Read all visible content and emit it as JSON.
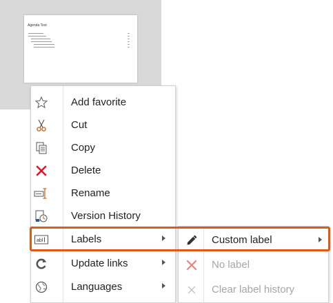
{
  "thumbnail": {
    "title": "Agenda Test"
  },
  "menu": {
    "items": [
      {
        "label": "Add favorite",
        "icon": "star-outline-icon"
      },
      {
        "label": "Cut",
        "icon": "scissors-icon"
      },
      {
        "label": "Copy",
        "icon": "copy-icon"
      },
      {
        "label": "Delete",
        "icon": "delete-x-icon"
      },
      {
        "label": "Rename",
        "icon": "rename-icon"
      },
      {
        "label": "Version History",
        "icon": "version-history-icon"
      },
      {
        "label": "Labels",
        "icon": "label-abc-icon"
      },
      {
        "label": "Update links",
        "icon": "refresh-icon"
      },
      {
        "label": "Languages",
        "icon": "globe-icon"
      }
    ]
  },
  "submenu": {
    "items": [
      {
        "label": "Custom label",
        "icon": "pencil-icon",
        "enabled": true
      },
      {
        "label": "No label",
        "icon": "red-x-icon",
        "enabled": false
      },
      {
        "label": "Clear label history",
        "icon": "grey-x-icon",
        "enabled": false
      }
    ]
  },
  "colors": {
    "highlight": "#e05a16",
    "delete_red": "#e81123",
    "scissors_orange": "#d2691e"
  }
}
